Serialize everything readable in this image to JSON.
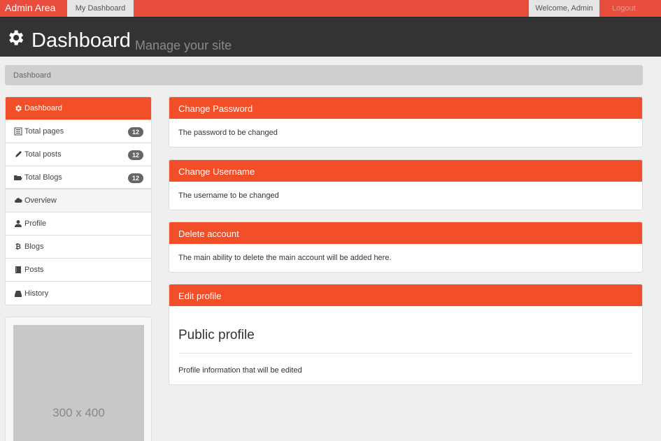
{
  "navbar": {
    "brand": "Admin Area",
    "active_item": "My Dashboard",
    "welcome": "Welcome, Admin",
    "logout": "Logout"
  },
  "header": {
    "title": "Dashboard",
    "subtitle": "Manage your site",
    "icon": "gear-icon"
  },
  "breadcrumb": {
    "current": "Dashboard"
  },
  "sidebar": {
    "items": [
      {
        "label": "Dashboard",
        "icon": "gear-icon"
      },
      {
        "label": "Total pages",
        "icon": "list-icon",
        "badge": "12"
      },
      {
        "label": "Total posts",
        "icon": "pencil-icon",
        "badge": "12"
      },
      {
        "label": "Total Blogs",
        "icon": "folder-open-icon",
        "badge": "12"
      },
      {
        "label": "Overview",
        "icon": "cloud-icon"
      },
      {
        "label": "Profile",
        "icon": "user-icon"
      },
      {
        "label": "Blogs",
        "icon": "bitcoin-icon"
      },
      {
        "label": "Posts",
        "icon": "book-icon"
      },
      {
        "label": "History",
        "icon": "hdd-icon"
      }
    ]
  },
  "thumbnail": {
    "text": "300 x 400"
  },
  "panels": [
    {
      "title": "Change Password",
      "body": "The password to be changed"
    },
    {
      "title": "Change Username",
      "body": "The username to be changed"
    },
    {
      "title": "Delete account",
      "body": "The main ability to delete the main account will be added here."
    },
    {
      "title": "Edit profile",
      "subtitle": "Public profile",
      "body": "Profile information that will be edited"
    }
  ],
  "colors": {
    "accent": "#f24e27",
    "navbar": "#e84c3d",
    "header_bg": "#333333",
    "badge": "#666666"
  }
}
